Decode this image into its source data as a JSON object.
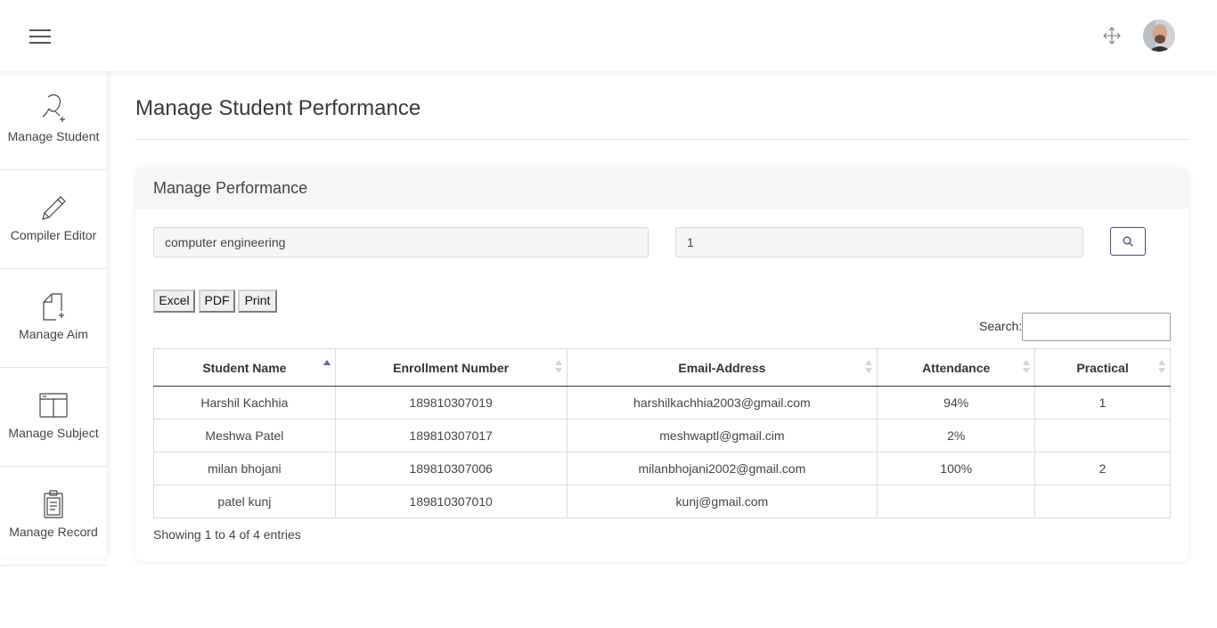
{
  "sidebar": {
    "items": [
      {
        "label": "Manage Student",
        "icon": "user-add-icon"
      },
      {
        "label": "Compiler Editor",
        "icon": "pencil-icon"
      },
      {
        "label": "Manage Aim",
        "icon": "file-add-icon"
      },
      {
        "label": "Manage Subject",
        "icon": "layout-icon"
      },
      {
        "label": "Manage Record",
        "icon": "clipboard-icon"
      }
    ]
  },
  "header": {
    "menu_icon": "hamburger-icon",
    "fullscreen_icon": "expand-arrows-icon",
    "avatar": "user-avatar"
  },
  "page": {
    "title": "Manage Student Performance"
  },
  "card": {
    "title": "Manage Performance",
    "filters": {
      "department_value": "computer engineering",
      "semester_value": "1",
      "search_icon": "search-icon"
    },
    "export_buttons": [
      "Excel",
      "PDF",
      "Print"
    ],
    "search_label": "Search:",
    "search_value": "",
    "table": {
      "columns": [
        "Student Name",
        "Enrollment Number",
        "Email-Address",
        "Attendance",
        "Practical"
      ],
      "rows": [
        [
          "Harshil Kachhia",
          "189810307019",
          "harshilkachhia2003@gmail.com",
          "94%",
          "1"
        ],
        [
          "Meshwa Patel",
          "189810307017",
          "meshwaptl@gmail.cim",
          "2%",
          ""
        ],
        [
          "milan bhojani",
          "189810307006",
          "milanbhojani2002@gmail.com",
          "100%",
          "2"
        ],
        [
          "patel kunj",
          "189810307010",
          "kunj@gmail.com",
          "",
          ""
        ]
      ]
    },
    "info": "Showing 1 to 4 of 4 entries"
  },
  "colors": {
    "accent": "#5a3f8a",
    "sort_active": "#5b63c7"
  }
}
